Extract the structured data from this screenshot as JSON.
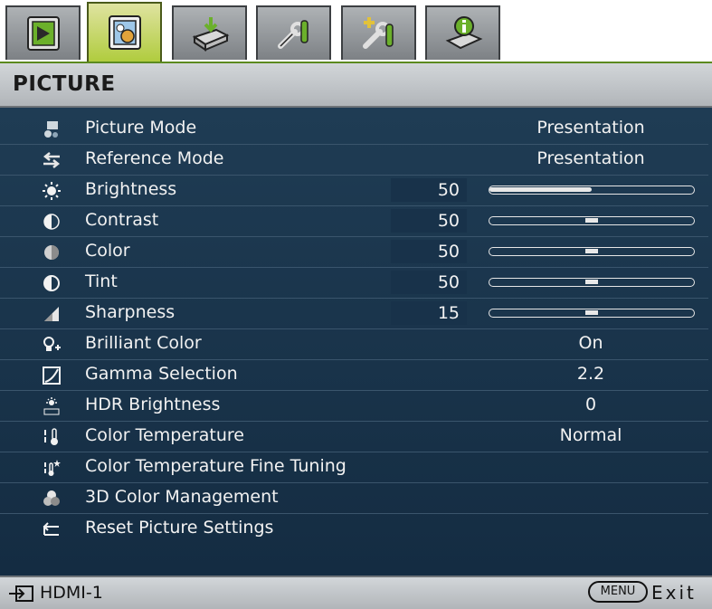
{
  "tabs": [
    {
      "icon": "display-settings-icon",
      "active": false
    },
    {
      "icon": "picture-icon",
      "active": true
    },
    {
      "icon": "source-icon",
      "active": false
    },
    {
      "icon": "system-setup-basic-icon",
      "active": false
    },
    {
      "icon": "system-setup-advanced-icon",
      "active": false
    },
    {
      "icon": "information-icon",
      "active": false
    }
  ],
  "header": {
    "title": "PICTURE"
  },
  "menu": {
    "items": [
      {
        "icon": "picture-mode-icon",
        "label": "Picture Mode",
        "value": "Presentation"
      },
      {
        "icon": "reference-mode-icon",
        "label": "Reference Mode",
        "value": "Presentation"
      },
      {
        "icon": "brightness-icon",
        "label": "Brightness",
        "number": "50",
        "level": 0.5,
        "slider": "fill"
      },
      {
        "icon": "contrast-icon",
        "label": "Contrast",
        "number": "50",
        "level": 0.5,
        "slider": "mark"
      },
      {
        "icon": "color-icon",
        "label": "Color",
        "number": "50",
        "level": 0.5,
        "slider": "mark"
      },
      {
        "icon": "tint-icon",
        "label": "Tint",
        "number": "50",
        "level": 0.5,
        "slider": "mark"
      },
      {
        "icon": "sharpness-icon",
        "label": "Sharpness",
        "number": "15",
        "level": 0.5,
        "slider": "mark"
      },
      {
        "icon": "brilliant-color-icon",
        "label": "Brilliant Color",
        "value": "On"
      },
      {
        "icon": "gamma-icon",
        "label": "Gamma Selection",
        "value": "2.2"
      },
      {
        "icon": "hdr-brightness-icon",
        "label": "HDR Brightness",
        "value": "0"
      },
      {
        "icon": "color-temperature-icon",
        "label": "Color Temperature",
        "value": "Normal"
      },
      {
        "icon": "color-temperature-tuning-icon",
        "label": "Color Temperature Fine Tuning"
      },
      {
        "icon": "3d-color-icon",
        "label": "3D Color Management"
      },
      {
        "icon": "reset-icon",
        "label": "Reset Picture Settings"
      }
    ]
  },
  "footer": {
    "source_label": "HDMI-1",
    "menu_key_label": "MENU",
    "exit_label": "Exit"
  },
  "colors": {
    "menu_background": "#1f3c54",
    "header_background": "#c4c8cb",
    "active_tab": "#b0cc3e",
    "text": "#f2f2f2"
  }
}
